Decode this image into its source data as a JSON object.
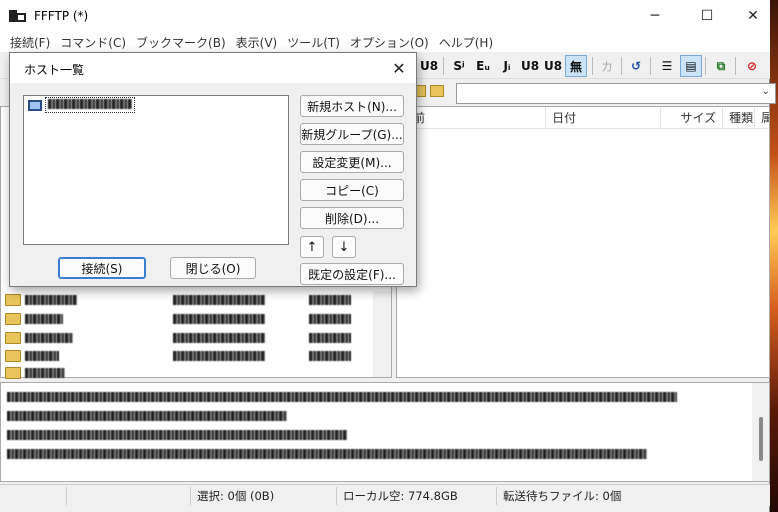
{
  "window": {
    "title": "FFFTP (*)"
  },
  "window_buttons": {
    "minimize": "─",
    "maximize": "☐",
    "close": "✕"
  },
  "menu": [
    "接続(F)",
    "コマンド(C)",
    "ブックマーク(B)",
    "表示(V)",
    "ツール(T)",
    "オプション(O)",
    "ヘルプ(H)"
  ],
  "toolbar": {
    "buttons": [
      {
        "name": "utf8n",
        "label": "U8"
      },
      {
        "name": "sjis",
        "label": "Sʲ"
      },
      {
        "name": "euc",
        "label": "Eᵤ"
      },
      {
        "name": "jis",
        "label": "Jᵢ"
      },
      {
        "name": "utf8bom",
        "label": "U8"
      },
      {
        "name": "utf8",
        "label": "U8"
      },
      {
        "name": "none",
        "label": "無"
      },
      {
        "name": "kana",
        "label": "カ"
      }
    ],
    "refresh_glyph": "↺",
    "list_glyph": "☰",
    "detail_glyph": "▤",
    "tree_glyph": "⧉",
    "stop_glyph": "⊘"
  },
  "remote_pane": {
    "columns": [
      "前",
      "日付",
      "サイズ",
      "種類",
      "属"
    ]
  },
  "host_dialog": {
    "title": "ホスト一覧",
    "close_glyph": "✕",
    "buttons": {
      "new_host": "新規ホスト(N)...",
      "new_group": "新規グループ(G)...",
      "edit": "設定変更(M)...",
      "copy": "コピー(C)",
      "delete": "削除(D)...",
      "up": "↑",
      "down": "↓",
      "default": "既定の設定(F)...",
      "connect": "接続(S)",
      "close": "閉じる(O)"
    }
  },
  "statusbar": {
    "selection": "選択: 0個 (0B)",
    "local_free": "ローカル空: 774.8GB",
    "queue": "転送待ちファイル: 0個"
  },
  "colors": {
    "accent": "#3a7dd4",
    "folder": "#e8c45a",
    "toolbar_active": "#cce4f7"
  }
}
